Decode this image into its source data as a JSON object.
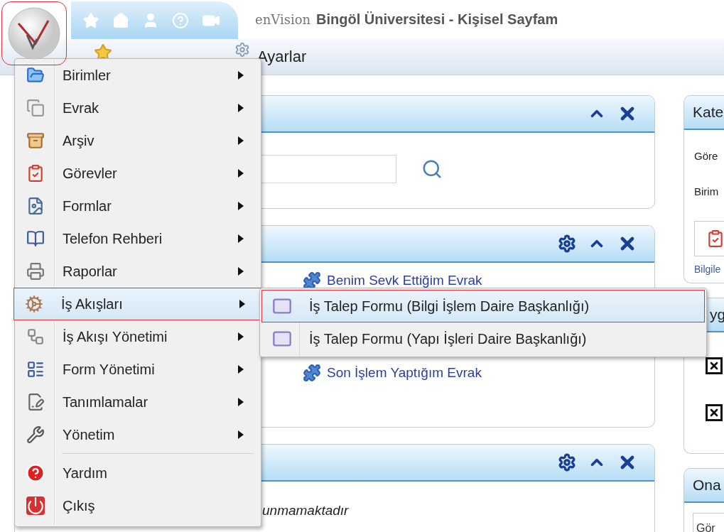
{
  "header": {
    "logo_highlighted": true,
    "brand": "enVision",
    "title": "Bingöl Üniversitesi - Kişisel Sayfam"
  },
  "toolbar": {
    "items": [
      {
        "label": "Ayarlar"
      }
    ]
  },
  "main_panels": [
    {
      "kind": "search",
      "gear": false
    },
    {
      "kind": "links",
      "gear": true,
      "links": [
        "Benim Sevk Ettiğim Evrak",
        "Son İşlem Yaptığım Evrak"
      ]
    },
    {
      "kind": "message",
      "gear": true,
      "message": "unmamaktadır"
    }
  ],
  "side_panels": [
    {
      "title": "Kate",
      "lines": [
        "Göre",
        "Birim"
      ],
      "footer": "Bilgile"
    },
    {
      "title": "yg",
      "checks": [
        {
          "checked": true
        },
        {
          "checked": true
        }
      ]
    },
    {
      "title": "Ona",
      "field": "Gör"
    }
  ],
  "menu": {
    "items": [
      {
        "label": "Birimler",
        "kind": "submenu",
        "selected": false
      },
      {
        "label": "Evrak",
        "kind": "submenu",
        "selected": false
      },
      {
        "label": "Arşiv",
        "kind": "submenu",
        "selected": false
      },
      {
        "label": "Görevler",
        "kind": "submenu",
        "selected": false
      },
      {
        "label": "Formlar",
        "kind": "submenu",
        "selected": false
      },
      {
        "label": "Telefon Rehberi",
        "kind": "submenu",
        "selected": false
      },
      {
        "label": "Raporlar",
        "kind": "submenu",
        "selected": false
      },
      {
        "label": "İş Akışları",
        "kind": "submenu",
        "selected": true
      },
      {
        "label": "İş Akışı Yönetimi",
        "kind": "submenu",
        "selected": false
      },
      {
        "label": "Form Yönetimi",
        "kind": "submenu",
        "selected": false
      },
      {
        "label": "Tanımlamalar",
        "kind": "submenu",
        "selected": false
      },
      {
        "label": "Yönetim",
        "kind": "submenu",
        "selected": false
      },
      {
        "label": "Yardım",
        "kind": "command",
        "selected": false
      },
      {
        "label": "Çıkış",
        "kind": "command",
        "selected": false
      }
    ]
  },
  "submenu": {
    "items": [
      {
        "label": "İş Talep Formu (Bilgi İşlem Daire Başkanlığı)",
        "selected": true
      },
      {
        "label": "İş Talep Formu (Yapı İşleri Daire Başkanlığı)",
        "selected": false
      }
    ]
  }
}
